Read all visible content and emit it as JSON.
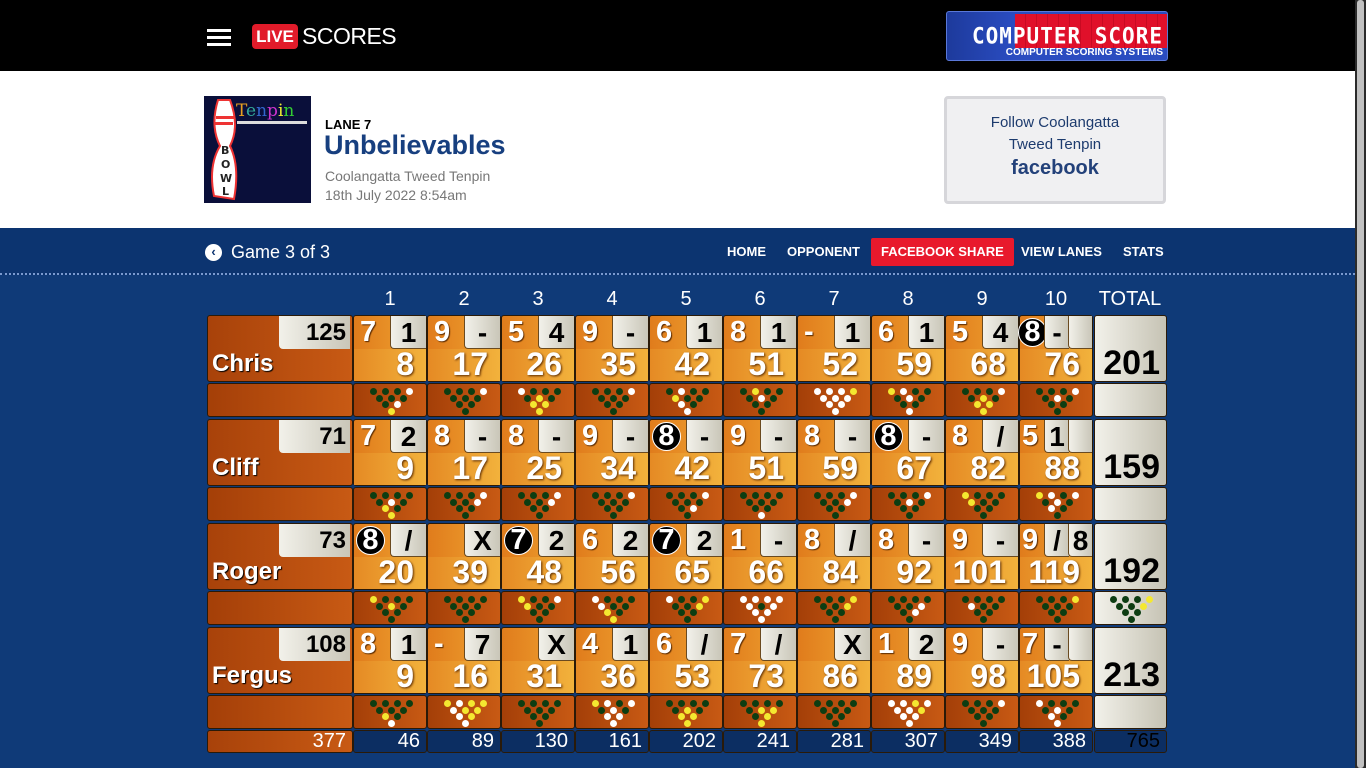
{
  "topbar": {
    "live": "LIVE",
    "scores": "SCORES",
    "sponsor_logo": {
      "line1": "COMPUTER SCORE",
      "line2": "COMPUTER SCORING SYSTEMS"
    }
  },
  "header": {
    "logo_text": "Tenpin BOWL",
    "lane": "LANE 7",
    "team": "Unbelievables",
    "venue": "Coolangatta Tweed Tenpin",
    "date": "18th July 2022 8:54am"
  },
  "follow": {
    "line1": "Follow Coolangatta",
    "line2": "Tweed Tenpin",
    "brand": "facebook"
  },
  "nav": {
    "game": "Game 3 of 3",
    "items": [
      {
        "label": "HOME",
        "active": false
      },
      {
        "label": "OPPONENT",
        "active": false
      },
      {
        "label": "FACEBOOK SHARE",
        "active": true
      },
      {
        "label": "VIEW LANES",
        "active": false
      },
      {
        "label": "STATS",
        "active": false
      }
    ]
  },
  "colors": {
    "accent": "#e8192c",
    "background": "#0f3a78",
    "pin_down": "#0d3d12",
    "pin_standing": "#ffffff",
    "pin_second_ball": "#f4e830"
  },
  "board": {
    "headers": [
      "1",
      "2",
      "3",
      "4",
      "5",
      "6",
      "7",
      "8",
      "9",
      "10"
    ],
    "total_header": "TOTAL",
    "players": [
      {
        "name": "Chris",
        "hcp": "125",
        "total": "201",
        "frames": [
          {
            "balls": [
              "7",
              "1"
            ],
            "cum": "8",
            "pins": "dddwddddwy"
          },
          {
            "balls": [
              "9",
              "-"
            ],
            "cum": "17",
            "pins": "dddwdddddd"
          },
          {
            "balls": [
              "5",
              "4"
            ],
            "cum": "26",
            "pins": "wddddydyyy"
          },
          {
            "balls": [
              "9",
              "-"
            ],
            "cum": "35",
            "pins": "dddwdddddd"
          },
          {
            "balls": [
              "6",
              "1"
            ],
            "cum": "42",
            "pins": "dwddyddwdw"
          },
          {
            "balls": [
              "8",
              "1"
            ],
            "cum": "51",
            "pins": "dydddwdddd"
          },
          {
            "balls": [
              "-",
              "1"
            ],
            "cum": "52",
            "pins": "wwwywwwwww"
          },
          {
            "balls": [
              "6",
              "1"
            ],
            "cum": "59",
            "pins": "ywdddwdddw"
          },
          {
            "balls": [
              "5",
              "4"
            ],
            "cum": "68",
            "pins": "dddwdydyyy"
          },
          {
            "balls": [
              "8",
              "-",
              ""
            ],
            "split": true,
            "cum": "76",
            "pins": "dddwdwdddd"
          }
        ]
      },
      {
        "name": "Cliff",
        "hcp": "71",
        "total": "159",
        "frames": [
          {
            "balls": [
              "7",
              "2"
            ],
            "cum": "9",
            "pins": "dddddwdydy"
          },
          {
            "balls": [
              "8",
              "-"
            ],
            "cum": "17",
            "pins": "dddwddwddd"
          },
          {
            "balls": [
              "8",
              "-"
            ],
            "cum": "25",
            "pins": "dddwddwddd"
          },
          {
            "balls": [
              "9",
              "-"
            ],
            "cum": "34",
            "pins": "dddwdddddd"
          },
          {
            "balls": [
              "8",
              "-"
            ],
            "split": true,
            "cum": "42",
            "pins": "dddwddddwd"
          },
          {
            "balls": [
              "9",
              "-"
            ],
            "cum": "51",
            "pins": "dddddddddw"
          },
          {
            "balls": [
              "8",
              "-"
            ],
            "cum": "59",
            "pins": "dddwddwddd"
          },
          {
            "balls": [
              "8",
              "-"
            ],
            "split": true,
            "cum": "67",
            "pins": "dddwdwdddd"
          },
          {
            "balls": [
              "8",
              "/"
            ],
            "cum": "82",
            "pins": "ydddyddddd"
          },
          {
            "balls": [
              "5",
              "1",
              ""
            ],
            "cum": "88",
            "pins": "ywdwdwdwdd"
          }
        ]
      },
      {
        "name": "Roger",
        "hcp": "73",
        "total": "192",
        "total_pins": "dddyddyddd",
        "frames": [
          {
            "balls": [
              "8",
              "/"
            ],
            "split": true,
            "cum": "20",
            "pins": "yddddydddd"
          },
          {
            "balls": [
              "",
              "X"
            ],
            "cum": "39",
            "pins": "dddddddddd"
          },
          {
            "balls": [
              "7",
              "2"
            ],
            "split": true,
            "cum": "48",
            "pins": "yddwyddddd"
          },
          {
            "balls": [
              "6",
              "2"
            ],
            "cum": "56",
            "pins": "wdddwddydy"
          },
          {
            "balls": [
              "7",
              "2"
            ],
            "split": true,
            "cum": "65",
            "pins": "wddyddyddd"
          },
          {
            "balls": [
              "1",
              "-"
            ],
            "cum": "66",
            "pins": "wwwwwdwwww"
          },
          {
            "balls": [
              "8",
              "/"
            ],
            "cum": "84",
            "pins": "dddyddyddd"
          },
          {
            "balls": [
              "8",
              "-"
            ],
            "cum": "92",
            "pins": "ddddddwdwd"
          },
          {
            "balls": [
              "9",
              "-"
            ],
            "cum": "101",
            "pins": "ddddwddddd"
          },
          {
            "balls": [
              "9",
              "/",
              "8"
            ],
            "cum": "119",
            "pins": "dddydddddd"
          }
        ]
      },
      {
        "name": "Fergus",
        "hcp": "108",
        "total": "213",
        "frames": [
          {
            "balls": [
              "8",
              "1"
            ],
            "cum": "9",
            "pins": "dddddddydw"
          },
          {
            "balls": [
              "-",
              "7"
            ],
            "cum": "16",
            "pins": "ywyywyywyw"
          },
          {
            "balls": [
              "",
              "X"
            ],
            "cum": "31",
            "pins": "dddddddddd"
          },
          {
            "balls": [
              "4",
              "1"
            ],
            "cum": "36",
            "pins": "ywdwdwdwww"
          },
          {
            "balls": [
              "6",
              "/"
            ],
            "cum": "53",
            "pins": "dddddydyyy"
          },
          {
            "balls": [
              "7",
              "/"
            ],
            "cum": "73",
            "pins": "dddddyydyy"
          },
          {
            "balls": [
              "",
              "X"
            ],
            "cum": "86",
            "pins": "dddddddddd"
          },
          {
            "balls": [
              "1",
              "2"
            ],
            "cum": "89",
            "pins": "wwywwwywww"
          },
          {
            "balls": [
              "9",
              "-"
            ],
            "cum": "98",
            "pins": "dddwdddddd"
          },
          {
            "balls": [
              "7",
              "-",
              ""
            ],
            "cum": "105",
            "pins": "wddddwdwdw"
          }
        ]
      }
    ],
    "footer": {
      "handicap_total": "377",
      "frame_totals": [
        "46",
        "89",
        "130",
        "161",
        "202",
        "241",
        "281",
        "307",
        "349",
        "388"
      ],
      "grand_total": "765"
    }
  }
}
